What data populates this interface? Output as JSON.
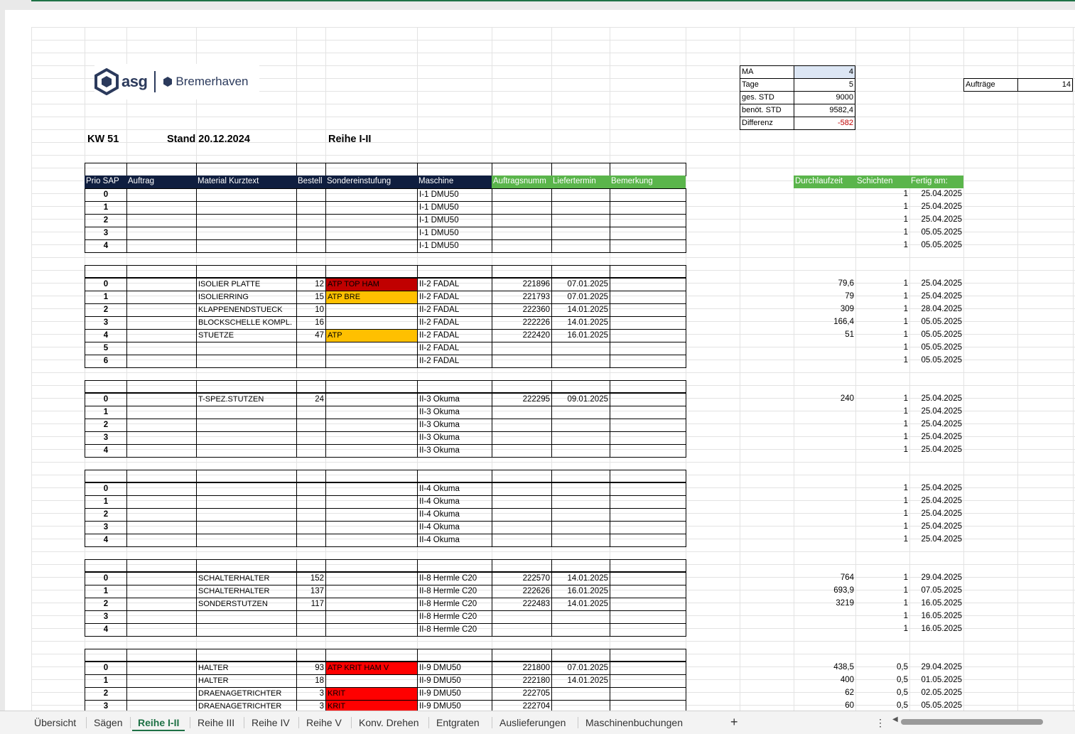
{
  "header": {
    "kw": "KW 51",
    "stand": "Stand 20.12.2024",
    "reihe": "Reihe I-II"
  },
  "logo": {
    "brand": "asg",
    "location": "Bremerhaven"
  },
  "summary": [
    {
      "label": "MA",
      "value": "4"
    },
    {
      "label": "Tage",
      "value": "5"
    },
    {
      "label": "ges. STD",
      "value": "9000"
    },
    {
      "label": "benöt. STD",
      "value": "9582,4"
    },
    {
      "label": "Differenz",
      "value": "-582"
    }
  ],
  "auftraege": {
    "label": "Aufträge",
    "value": "14"
  },
  "columns": [
    "Prio SAP",
    "Auftrag",
    "Material Kurztext",
    "Bestell",
    "Sondereinstufung",
    "Maschine",
    "Auftragsnumm",
    "Liefertermin",
    "Bemerkung"
  ],
  "right_columns": [
    "Durchlaufzeit",
    "Schichten",
    "Fertig am:"
  ],
  "groups": [
    {
      "rows": [
        {
          "prio": "0",
          "material": "",
          "bestell": "",
          "sonder": "",
          "maschine": "I-1 DMU50",
          "auftragsnr": "",
          "liefer": "",
          "dlz": "",
          "schicht": "1",
          "fertig": "25.04.2025"
        },
        {
          "prio": "1",
          "material": "",
          "bestell": "",
          "sonder": "",
          "maschine": "I-1 DMU50",
          "auftragsnr": "",
          "liefer": "",
          "dlz": "",
          "schicht": "1",
          "fertig": "25.04.2025"
        },
        {
          "prio": "2",
          "material": "",
          "bestell": "",
          "sonder": "",
          "maschine": "I-1 DMU50",
          "auftragsnr": "",
          "liefer": "",
          "dlz": "",
          "schicht": "1",
          "fertig": "25.04.2025"
        },
        {
          "prio": "3",
          "material": "",
          "bestell": "",
          "sonder": "",
          "maschine": "I-1 DMU50",
          "auftragsnr": "",
          "liefer": "",
          "dlz": "",
          "schicht": "1",
          "fertig": "05.05.2025"
        },
        {
          "prio": "4",
          "material": "",
          "bestell": "",
          "sonder": "",
          "maschine": "I-1 DMU50",
          "auftragsnr": "",
          "liefer": "",
          "dlz": "",
          "schicht": "1",
          "fertig": "05.05.2025"
        }
      ]
    },
    {
      "rows": [
        {
          "prio": "0",
          "material": "ISOLIER PLATTE",
          "bestell": "12",
          "sonder": "ATP TOP HAM",
          "sonder_color": "#c00000",
          "maschine": "II-2 FADAL",
          "auftragsnr": "221896",
          "liefer": "07.01.2025",
          "dlz": "79,6",
          "schicht": "1",
          "fertig": "25.04.2025"
        },
        {
          "prio": "1",
          "material": "ISOLIERRING",
          "bestell": "15",
          "sonder": "ATP BRE",
          "sonder_color": "#ffc000",
          "maschine": "II-2 FADAL",
          "auftragsnr": "221793",
          "liefer": "07.01.2025",
          "dlz": "79",
          "schicht": "1",
          "fertig": "25.04.2025"
        },
        {
          "prio": "2",
          "material": "KLAPPENENDSTUECK",
          "bestell": "10",
          "sonder": "",
          "maschine": "II-2 FADAL",
          "auftragsnr": "222360",
          "liefer": "14.01.2025",
          "dlz": "309",
          "schicht": "1",
          "fertig": "28.04.2025"
        },
        {
          "prio": "3",
          "material": "BLOCKSCHELLE KOMPL.",
          "bestell": "16",
          "sonder": "",
          "maschine": "II-2 FADAL",
          "auftragsnr": "222226",
          "liefer": "14.01.2025",
          "dlz": "166,4",
          "schicht": "1",
          "fertig": "05.05.2025"
        },
        {
          "prio": "4",
          "material": "STUETZE",
          "bestell": "47",
          "sonder": "ATP",
          "sonder_color": "#ffc000",
          "maschine": "II-2 FADAL",
          "auftragsnr": "222420",
          "liefer": "16.01.2025",
          "dlz": "51",
          "schicht": "1",
          "fertig": "05.05.2025"
        },
        {
          "prio": "5",
          "material": "",
          "bestell": "",
          "sonder": "",
          "maschine": "II-2 FADAL",
          "auftragsnr": "",
          "liefer": "",
          "dlz": "",
          "schicht": "1",
          "fertig": "05.05.2025"
        },
        {
          "prio": "6",
          "material": "",
          "bestell": "",
          "sonder": "",
          "maschine": "II-2 FADAL",
          "auftragsnr": "",
          "liefer": "",
          "dlz": "",
          "schicht": "1",
          "fertig": "05.05.2025"
        }
      ]
    },
    {
      "rows": [
        {
          "prio": "0",
          "material": "T-SPEZ.STUTZEN",
          "bestell": "24",
          "sonder": "",
          "maschine": "II-3 Okuma",
          "auftragsnr": "222295",
          "liefer": "09.01.2025",
          "dlz": "240",
          "schicht": "1",
          "fertig": "25.04.2025"
        },
        {
          "prio": "1",
          "material": "",
          "bestell": "",
          "sonder": "",
          "maschine": "II-3 Okuma",
          "auftragsnr": "",
          "liefer": "",
          "dlz": "",
          "schicht": "1",
          "fertig": "25.04.2025"
        },
        {
          "prio": "2",
          "material": "",
          "bestell": "",
          "sonder": "",
          "maschine": "II-3 Okuma",
          "auftragsnr": "",
          "liefer": "",
          "dlz": "",
          "schicht": "1",
          "fertig": "25.04.2025"
        },
        {
          "prio": "3",
          "material": "",
          "bestell": "",
          "sonder": "",
          "maschine": "II-3 Okuma",
          "auftragsnr": "",
          "liefer": "",
          "dlz": "",
          "schicht": "1",
          "fertig": "25.04.2025"
        },
        {
          "prio": "4",
          "material": "",
          "bestell": "",
          "sonder": "",
          "maschine": "II-3 Okuma",
          "auftragsnr": "",
          "liefer": "",
          "dlz": "",
          "schicht": "1",
          "fertig": "25.04.2025"
        }
      ]
    },
    {
      "rows": [
        {
          "prio": "0",
          "material": "",
          "bestell": "",
          "sonder": "",
          "maschine": "II-4 Okuma",
          "auftragsnr": "",
          "liefer": "",
          "dlz": "",
          "schicht": "1",
          "fertig": "25.04.2025"
        },
        {
          "prio": "1",
          "material": "",
          "bestell": "",
          "sonder": "",
          "maschine": "II-4 Okuma",
          "auftragsnr": "",
          "liefer": "",
          "dlz": "",
          "schicht": "1",
          "fertig": "25.04.2025"
        },
        {
          "prio": "2",
          "material": "",
          "bestell": "",
          "sonder": "",
          "maschine": "II-4 Okuma",
          "auftragsnr": "",
          "liefer": "",
          "dlz": "",
          "schicht": "1",
          "fertig": "25.04.2025"
        },
        {
          "prio": "3",
          "material": "",
          "bestell": "",
          "sonder": "",
          "maschine": "II-4 Okuma",
          "auftragsnr": "",
          "liefer": "",
          "dlz": "",
          "schicht": "1",
          "fertig": "25.04.2025"
        },
        {
          "prio": "4",
          "material": "",
          "bestell": "",
          "sonder": "",
          "maschine": "II-4 Okuma",
          "auftragsnr": "",
          "liefer": "",
          "dlz": "",
          "schicht": "1",
          "fertig": "25.04.2025"
        }
      ]
    },
    {
      "rows": [
        {
          "prio": "0",
          "material": "SCHALTERHALTER",
          "bestell": "152",
          "sonder": "",
          "maschine": "II-8 Hermle C20",
          "auftragsnr": "222570",
          "liefer": "14.01.2025",
          "dlz": "764",
          "schicht": "1",
          "fertig": "29.04.2025"
        },
        {
          "prio": "1",
          "material": "SCHALTERHALTER",
          "bestell": "137",
          "sonder": "",
          "maschine": "II-8 Hermle C20",
          "auftragsnr": "222626",
          "liefer": "16.01.2025",
          "dlz": "693,9",
          "schicht": "1",
          "fertig": "07.05.2025"
        },
        {
          "prio": "2",
          "material": "SONDERSTUTZEN",
          "bestell": "117",
          "sonder": "",
          "maschine": "II-8 Hermle C20",
          "auftragsnr": "222483",
          "liefer": "14.01.2025",
          "dlz": "3219",
          "schicht": "1",
          "fertig": "16.05.2025"
        },
        {
          "prio": "3",
          "material": "",
          "bestell": "",
          "sonder": "",
          "maschine": "II-8 Hermle C20",
          "auftragsnr": "",
          "liefer": "",
          "dlz": "",
          "schicht": "1",
          "fertig": "16.05.2025"
        },
        {
          "prio": "4",
          "material": "",
          "bestell": "",
          "sonder": "",
          "maschine": "II-8 Hermle C20",
          "auftragsnr": "",
          "liefer": "",
          "dlz": "",
          "schicht": "1",
          "fertig": "16.05.2025"
        }
      ]
    },
    {
      "rows": [
        {
          "prio": "0",
          "material": "HALTER",
          "bestell": "93",
          "sonder": "ATP KRIT HAM V",
          "sonder_color": "#ff0000",
          "maschine": "II-9 DMU50",
          "auftragsnr": "221800",
          "liefer": "07.01.2025",
          "dlz": "438,5",
          "schicht": "0,5",
          "fertig": "29.04.2025"
        },
        {
          "prio": "1",
          "material": "HALTER",
          "bestell": "18",
          "sonder": "",
          "maschine": "II-9 DMU50",
          "auftragsnr": "222180",
          "liefer": "14.01.2025",
          "dlz": "400",
          "schicht": "0,5",
          "fertig": "01.05.2025"
        },
        {
          "prio": "2",
          "material": "DRAENAGETRICHTER",
          "bestell": "3",
          "sonder": "KRIT",
          "sonder_color": "#ff0000",
          "maschine": "II-9 DMU50",
          "auftragsnr": "222705",
          "liefer": "",
          "dlz": "62",
          "schicht": "0,5",
          "fertig": "02.05.2025"
        },
        {
          "prio": "3",
          "material": "DRAENAGETRICHTER",
          "bestell": "3",
          "sonder": "KRIT",
          "sonder_color": "#ff0000",
          "maschine": "II-9 DMU50",
          "auftragsnr": "222704",
          "liefer": "",
          "dlz": "60",
          "schicht": "0,5",
          "fertig": "05.05.2025"
        }
      ]
    }
  ],
  "tabs": [
    "Übersicht",
    "Sägen",
    "Reihe I-II",
    "Reihe III",
    "Reihe IV",
    "Reihe V",
    "Konv. Drehen",
    "Entgraten",
    "Auslieferungen",
    "Maschinenbuchungen"
  ],
  "active_tab": "Reihe I-II",
  "add_sheet": "+",
  "more": "⋮",
  "scroll_left": "◀",
  "colors": {
    "header_dark": "#0f1e3f",
    "header_green": "#5ab54b",
    "negative": "#c00000",
    "summary_highlight": "#dce6f4"
  }
}
